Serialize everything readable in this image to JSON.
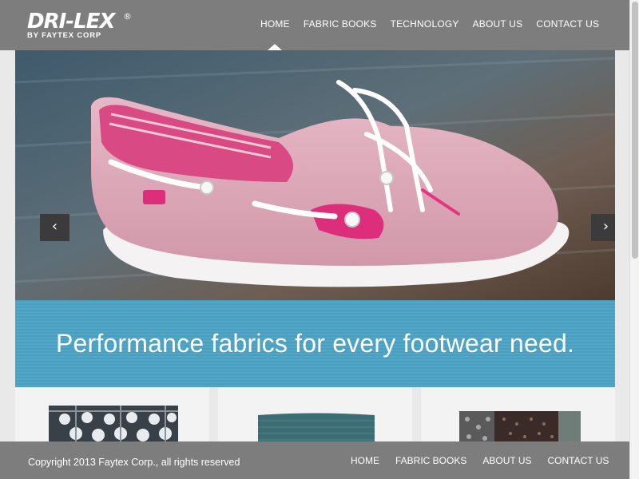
{
  "brand": {
    "logo_text": "DRI-LEX",
    "logo_registered": "®",
    "logo_tagline": "BY FAYTEX CORP"
  },
  "nav": {
    "items": [
      {
        "label": "HOME",
        "active": true
      },
      {
        "label": "FABRIC BOOKS"
      },
      {
        "label": "TECHNOLOGY"
      },
      {
        "label": "ABOUT US"
      },
      {
        "label": "CONTACT US"
      }
    ]
  },
  "hero": {
    "image": "pink-boat-shoe",
    "prev_icon": "chevron-left-icon",
    "next_icon": "chevron-right-icon",
    "prev_glyph": "‹",
    "next_glyph": "›"
  },
  "banner": {
    "headline": "Performance fabrics for every footwear need."
  },
  "cards": [
    {
      "image": "yarn-spools-photo"
    },
    {
      "image": "teal-mesh-fabric-swatch"
    },
    {
      "image": "patterned-fabric-swatches"
    }
  ],
  "footer": {
    "copyright": "Copyright 2013 Faytex Corp., all rights reserved",
    "links": [
      {
        "label": "HOME"
      },
      {
        "label": "FABRIC BOOKS"
      },
      {
        "label": "ABOUT US"
      },
      {
        "label": "CONTACT US"
      }
    ]
  },
  "colors": {
    "header_bg": "#7d7d7d",
    "banner_bg": "#4a9ec0",
    "slider_btn_bg": "#3b3b3b",
    "card_bg": "#f3f3f3"
  }
}
